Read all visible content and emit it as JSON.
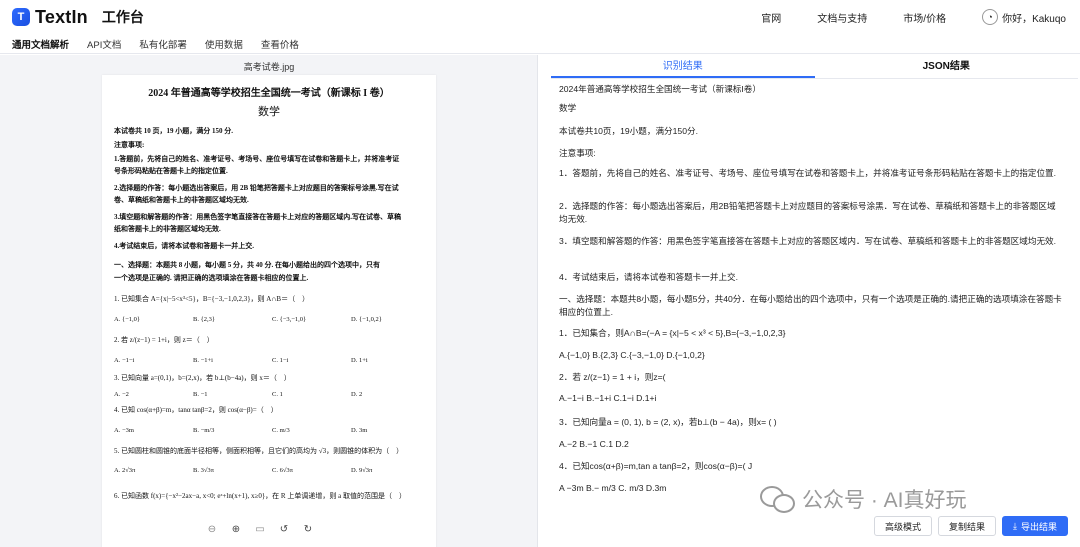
{
  "app": {
    "logo_mark": "T",
    "logo_text": "TextIn",
    "workspace": "工作台"
  },
  "topnav": {
    "items": [
      "官网",
      "文档与支持",
      "市场/价格"
    ],
    "user_avatar": "◔",
    "user_greeting": "你好，Kakuqo"
  },
  "subnav": {
    "items": [
      "通用文档解析",
      "API文档",
      "私有化部署",
      "使用数据",
      "查看价格"
    ]
  },
  "left": {
    "filename": "高考试卷.jpg",
    "doc": {
      "title": "2024 年普通高等学校招生全国统一考试（新课标 I 卷）",
      "subject": "数学",
      "lines": [
        "本试卷共 10 页，19 小题，满分 150 分.",
        "注意事项:",
        "1.答题前，先将自己的姓名、准考证号、考场号、座位号填写在试卷和答题卡上，并将准考证",
        "号条形码粘贴在答题卡上的指定位置.",
        "2.选择题的作答：每小题选出答案后，用 2B 铅笔把答题卡上对应题目的答案标号涂黑.写在试",
        "卷、草稿纸和答题卡上的非答题区域均无效.",
        "3.填空题和解答题的作答：用黑色签字笔直接答在答题卡上对应的答题区域内.写在试卷、草稿",
        "纸和答题卡上的非答题区域均无效.",
        "4.考试结束后，请将本试卷和答题卡一并上交.",
        "一、选择题：本题共 8 小题，每小题 5 分，共 40 分. 在每小题给出的四个选项中，只有",
        "一个选项是正确的. 请把正确的选项填涂在答题卡相应的位置上."
      ],
      "questions": [
        {
          "q": "1. 已知集合 A={x|−5<x³<5}，B={−3,−1,0,2,3}，则 A∩B＝（　）",
          "opts": [
            "A. {−1,0}",
            "B. {2,3}",
            "C. {−3,−1,0}",
            "D. {−1,0,2}"
          ]
        },
        {
          "q": "2. 若 z/(z−1) = 1+i，则 z＝（　）",
          "opts": [
            "A. −1−i",
            "B. −1+i",
            "C. 1−i",
            "D. 1+i"
          ]
        },
        {
          "q": "3. 已知向量 a=(0,1)，b=(2,x)，若 b⊥(b−4a)，则 x＝（　）",
          "opts": [
            "A. −2",
            "B. −1",
            "C. 1",
            "D. 2"
          ]
        },
        {
          "q": "4. 已知 cos(α+β)=m，tanα tanβ=2，则 cos(α−β)=（　）",
          "opts": [
            "A. −3m",
            "B. −m/3",
            "C. m/3",
            "D. 3m"
          ]
        },
        {
          "q": "5. 已知圆柱和圆锥的底面半径相等，侧面积相等，且它们的高均为 √3，则圆锥的体积为（　）",
          "opts": [
            "A. 2√3π",
            "B. 3√3π",
            "C. 6√3π",
            "D. 9√3π"
          ]
        },
        {
          "q": "6. 已知函数 f(x)={−x²−2ax−a, x<0; eˣ+ln(x+1), x≥0}，在 R 上单调递增，则 a 取值的范围是（　）",
          "opts": []
        }
      ]
    },
    "zoom_icons": [
      "zoom-out-icon",
      "zoom-in-icon",
      "fit-page-icon",
      "rotate-left-icon",
      "rotate-right-icon"
    ]
  },
  "right": {
    "tabs": [
      "识别结果",
      "JSON结果"
    ],
    "result_lines": [
      "2024年普通高等学校招生全国统一考试（新课标I卷）",
      "数学",
      "本试卷共10页，19小题，满分150分.",
      "注意事项:",
      "1．答题前，先将自己的姓名、准考证号、考场号、座位号填写在试卷和答题卡上，并将准考证号条形码粘贴在答题卡上的指定位置.",
      "2．选择题的作答：每小题选出答案后，用2B铅笔把答题卡上对应题目的答案标号涂黑．写在试卷、草稿纸和答题卡上的非答题区域均无效.",
      "3．填空题和解答题的作答：用黑色签字笔直接答在答题卡上对应的答题区域内．写在试卷、草稿纸和答题卡上的非答题区域均无效.",
      "4．考试结束后，请将本试卷和答题卡一并上交.",
      "一、选择题：本题共8小题，每小题5分，共40分．在每小题给出的四个选项中，只有一个选项是正确的.请把正确的选项填涂在答题卡相应的位置上.",
      "1．已知集合，则A∩B=(−A = {x|−5 < x³ < 5},B={−3,−1,0,2,3}",
      "A.{−1,0} B.{2,3} C.{−3,−1,0} D.{−1,0,2}",
      "2．若 z/(z−1) = 1 + i，则z=(",
      "A.−1−i B.−1+i C.1−i D.1+i",
      "3．已知向量a = (0, 1), b = (2, x)，若b⊥(b − 4a)，则x= ( )",
      "A.−2 B.−1 C.1 D.2",
      "4．已知cos(α+β)=m,tan a tanβ=2，则cos(α−β)=( J",
      "A −3m B.− m/3 C. m/3 D.3m"
    ],
    "buttons": {
      "advanced": "高级模式",
      "copy": "复制结果",
      "export": "导出结果"
    }
  },
  "watermark": "公众号 · AI真好玩"
}
